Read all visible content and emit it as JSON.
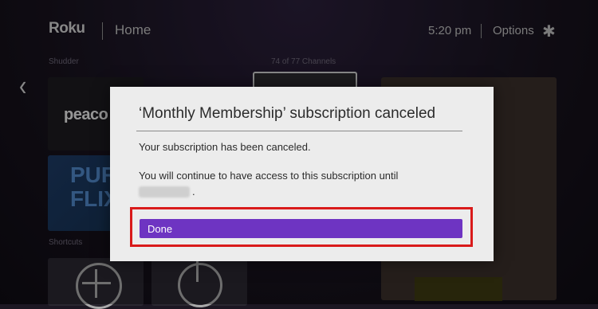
{
  "header": {
    "logo": "Roku",
    "title": "Home",
    "time": "5:20 pm",
    "options_label": "Options"
  },
  "background": {
    "section_label": "Shudder",
    "channel_count": "74 of 77 Channels",
    "shortcuts_label": "Shortcuts",
    "peacock_text": "peaco",
    "pure_flix_line1": "PUR",
    "pure_flix_line2": "FLIX"
  },
  "dialog": {
    "title": "‘Monthly Membership’ subscription canceled",
    "message1": "Your subscription has been canceled.",
    "message2": "You will continue to have access to this subscription until",
    "message2_end": ".",
    "button_label": "Done"
  },
  "colors": {
    "button": "#6e34c2",
    "highlight": "#d91a1a",
    "dialog_bg": "#ececec"
  }
}
